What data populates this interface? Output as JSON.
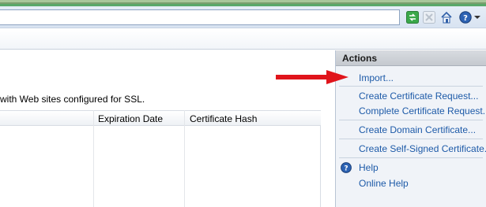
{
  "main": {
    "description": "with Web sites configured for SSL.",
    "columns": [
      "Expiration Date",
      "Certificate Hash"
    ]
  },
  "actions": {
    "title": "Actions",
    "items": [
      "Import...",
      "Create Certificate Request...",
      "Complete Certificate Request...",
      "Create Domain Certificate...",
      "Create Self-Signed Certificate...",
      "Help",
      "Online Help"
    ]
  },
  "icons": {
    "go": "refresh-go-icon",
    "stop": "stop-icon",
    "home": "home-icon",
    "help": "help-icon",
    "actions_help": "help-icon"
  },
  "colors": {
    "link": "#1d5aa8",
    "arrow": "#e0141b",
    "actions_bg": "#f0f3f8"
  }
}
